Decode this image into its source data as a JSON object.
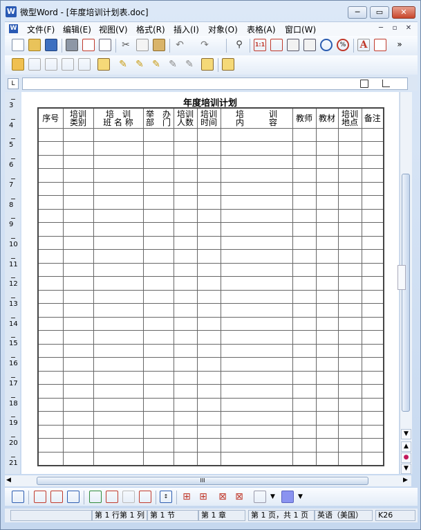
{
  "window": {
    "title": "微型Word - [年度培训计划表.doc]",
    "app_icon_letter": "W"
  },
  "menu": [
    "文件(F)",
    "编辑(E)",
    "视图(V)",
    "格式(R)",
    "插入(I)",
    "对象(O)",
    "表格(A)",
    "窗口(W)"
  ],
  "ruler": {
    "corner": "L",
    "vertical_numbers": [
      "3",
      "4",
      "5",
      "6",
      "7",
      "8",
      "9",
      "10",
      "11",
      "12",
      "13",
      "14",
      "15",
      "16",
      "17",
      "18",
      "19",
      "20",
      "21"
    ]
  },
  "document": {
    "title": "年度培训计划",
    "headers": [
      {
        "line1": "序号",
        "line2": ""
      },
      {
        "line1": "培训",
        "line2": "类别"
      },
      {
        "line1": "培　训",
        "line2": "班 名 称"
      },
      {
        "line1": "举　办",
        "line2": "部　门"
      },
      {
        "line1": "培训",
        "line2": "人数"
      },
      {
        "line1": "培训",
        "line2": "时间"
      },
      {
        "line1": "培　　　训",
        "line2": "内　　　容"
      },
      {
        "line1": "教师",
        "line2": ""
      },
      {
        "line1": "教材",
        "line2": ""
      },
      {
        "line1": "培训",
        "line2": "地点"
      },
      {
        "line1": "备注",
        "line2": ""
      }
    ]
  },
  "scroll": {
    "grip": "III"
  },
  "status": {
    "line_col": "第 1 行第 1 列",
    "section": "第 1 节",
    "chapter": "第 1 章",
    "page": "第 1 页，共 1 页",
    "language": "英语（美国）",
    "extra": "K26"
  },
  "colors": {
    "accent": "#2a5ab4",
    "frame": "#c9d9ee"
  }
}
